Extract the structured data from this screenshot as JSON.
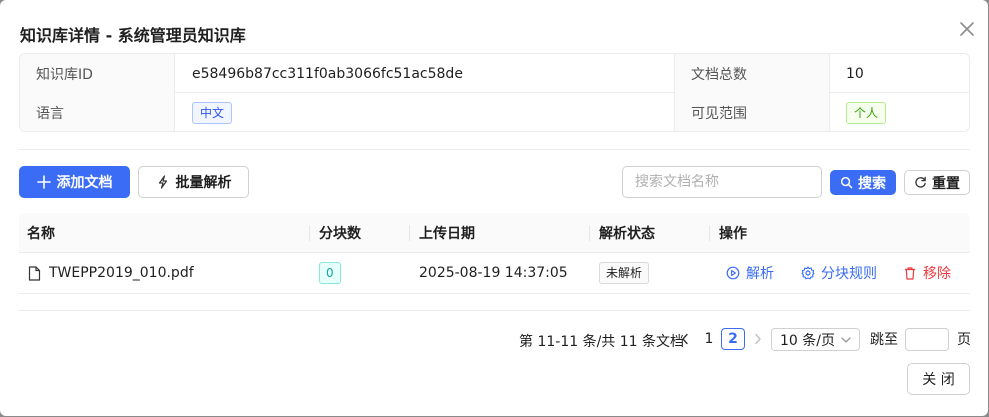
{
  "dialog": {
    "title": "知识库详情 - 系统管理员知识库",
    "close_icon": "close-icon"
  },
  "details": {
    "kb_id_label": "知识库ID",
    "kb_id_value": "e58496b87cc311f0ab3066fc51ac58de",
    "doc_count_label": "文档总数",
    "doc_count_value": "10",
    "language_label": "语言",
    "language_value": "中文",
    "visibility_label": "可见范围",
    "visibility_value": "个人"
  },
  "toolbar": {
    "add_doc_label": "添加文档",
    "batch_parse_label": "批量解析",
    "search_placeholder": "搜索文档名称",
    "search_label": "搜索",
    "reset_label": "重置"
  },
  "table": {
    "columns": [
      "名称",
      "分块数",
      "上传日期",
      "解析状态",
      "操作"
    ],
    "rows": [
      {
        "name": "TWEPP2019_010.pdf",
        "chunks": "0",
        "upload_date": "2025-08-19 14:37:05",
        "status": "未解析",
        "actions": {
          "parse": "解析",
          "chunk_rules": "分块规则",
          "remove": "移除"
        }
      }
    ]
  },
  "pagination": {
    "summary": "第 11-11 条/共 11 条文档",
    "pages": [
      "1",
      "2"
    ],
    "current_page": 2,
    "page_size": "10 条/页",
    "jump_label": "跳至",
    "page_suffix": "页"
  },
  "footer": {
    "close_label": "关 闭"
  },
  "colors": {
    "primary": "#3a6cf5",
    "danger": "#f0393e",
    "teal": "#13a8a8"
  }
}
